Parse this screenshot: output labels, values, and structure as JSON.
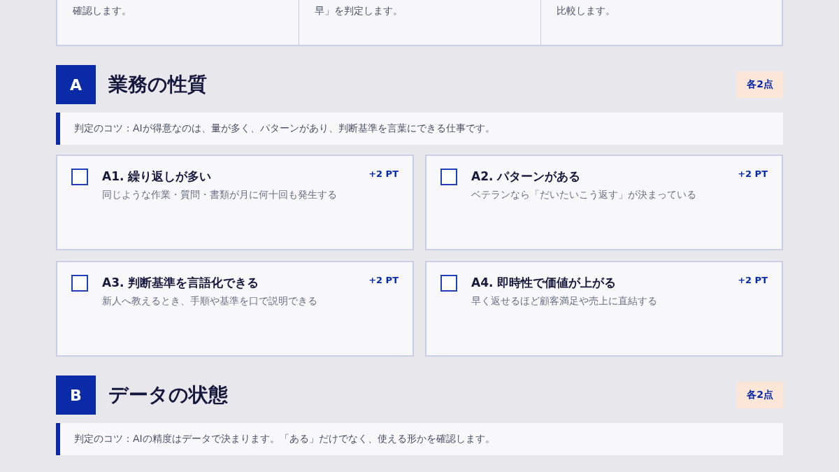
{
  "intro_cards": [
    {
      "text": "確認します。"
    },
    {
      "text": "早」を判定します。"
    },
    {
      "text": "比較します。"
    }
  ],
  "sections": [
    {
      "letter": "A",
      "title": "業務の性質",
      "badge": "各2点",
      "tip": "判定のコツ：AIが得意なのは、量が多く、パターンがあり、判断基準を言葉にできる仕事です。",
      "items": [
        {
          "checked": false,
          "title": "A1. 繰り返しが多い",
          "points": "+2 PT",
          "description": "同じような作業・質問・書類が月に何十回も発生する"
        },
        {
          "checked": false,
          "title": "A2. パターンがある",
          "points": "+2 PT",
          "description": "ベテランなら「だいたいこう返す」が決まっている"
        },
        {
          "checked": false,
          "title": "A3. 判断基準を言語化できる",
          "points": "+2 PT",
          "description": "新人へ教えるとき、手順や基準を口で説明できる"
        },
        {
          "checked": false,
          "title": "A4. 即時性で価値が上がる",
          "points": "+2 PT",
          "description": "早く返せるほど顧客満足や売上に直結する"
        }
      ]
    },
    {
      "letter": "B",
      "title": "データの状態",
      "badge": "各2点",
      "tip": "判定のコツ：AIの精度はデータで決まります。「ある」だけでなく、使える形かを確認します。"
    }
  ]
}
